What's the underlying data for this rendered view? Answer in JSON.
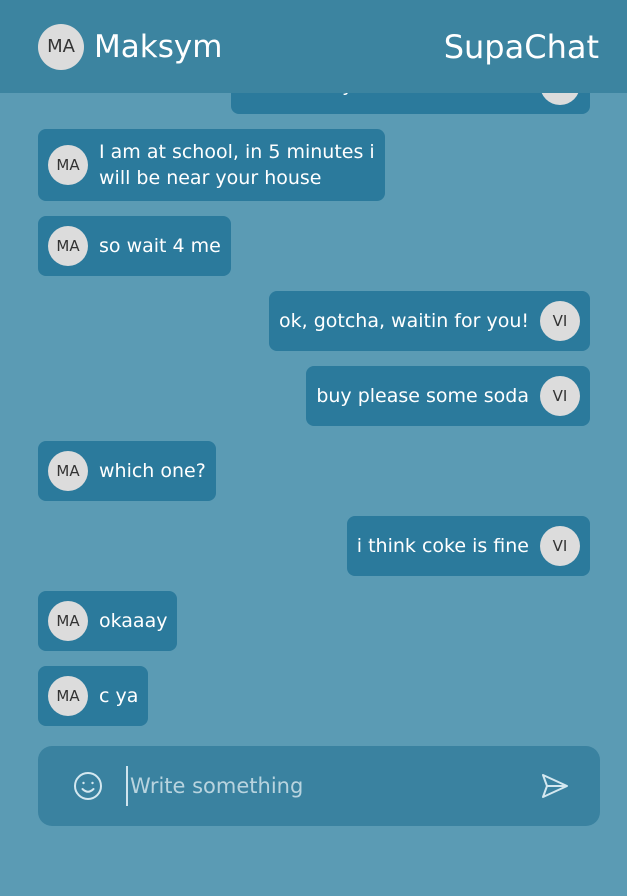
{
  "header": {
    "user_initials": "MA",
    "user_name": "Maksym",
    "app_title": "SupaChat"
  },
  "messages": [
    {
      "side": "right",
      "text": "where are you?",
      "initials": "VI"
    },
    {
      "side": "left",
      "text_lines": [
        "I am at school, in 5 minutes i",
        "will be near your house"
      ],
      "initials": "MA"
    },
    {
      "side": "left",
      "text": "so wait 4 me",
      "initials": "MA"
    },
    {
      "side": "right",
      "text": "ok, gotcha, waitin for you!",
      "initials": "VI"
    },
    {
      "side": "right",
      "text": "buy please some soda",
      "initials": "VI"
    },
    {
      "side": "left",
      "text": "which one?",
      "initials": "MA"
    },
    {
      "side": "right",
      "text": "i think coke is fine",
      "initials": "VI"
    },
    {
      "side": "left",
      "text": "okaaay",
      "initials": "MA"
    },
    {
      "side": "left",
      "text": "c ya",
      "initials": "MA"
    }
  ],
  "composer": {
    "placeholder": "Write something",
    "value": "",
    "emoji_icon": "smiley-icon",
    "send_icon": "send-icon"
  },
  "colors": {
    "background": "#5b9bb4",
    "header": "#3c84a0",
    "bubble": "#2b7a9c",
    "composer": "#3a82a0",
    "avatar": "#dcdcdc"
  }
}
